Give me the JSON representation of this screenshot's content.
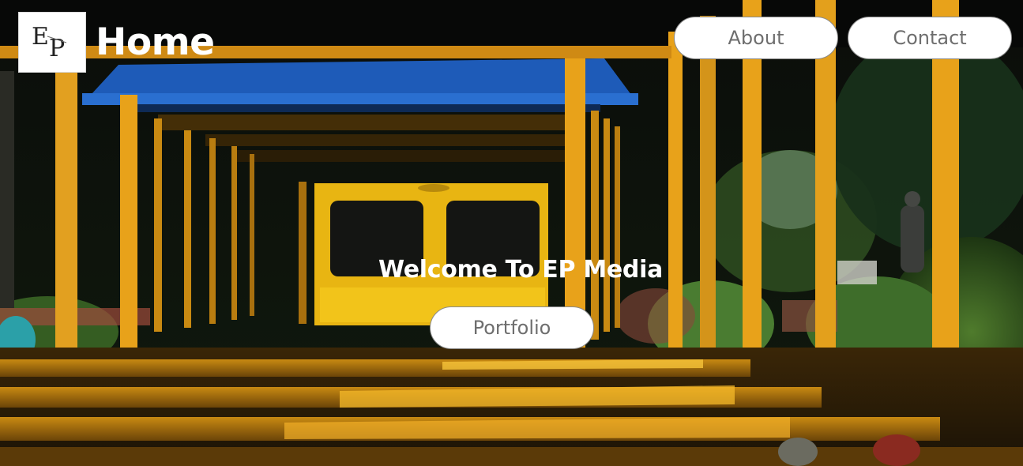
{
  "header": {
    "logo": {
      "letters": "EP",
      "icon": "ep-monogram-logo"
    },
    "title": "Home"
  },
  "nav": {
    "items": [
      {
        "label": "About"
      },
      {
        "label": "Contact"
      }
    ]
  },
  "hero": {
    "heading": "Welcome To EP Media",
    "cta_label": "Portfolio",
    "background": "photo of a yellow-framed park train under a blue canopy, foliage behind"
  },
  "colors": {
    "button_bg": "#ffffff",
    "button_text": "#6e6e6e",
    "heading_text": "#ffffff",
    "train_yellow": "#e8a21a",
    "canopy_blue": "#1f5fbf",
    "foliage_dark": "#0e1a0c"
  }
}
